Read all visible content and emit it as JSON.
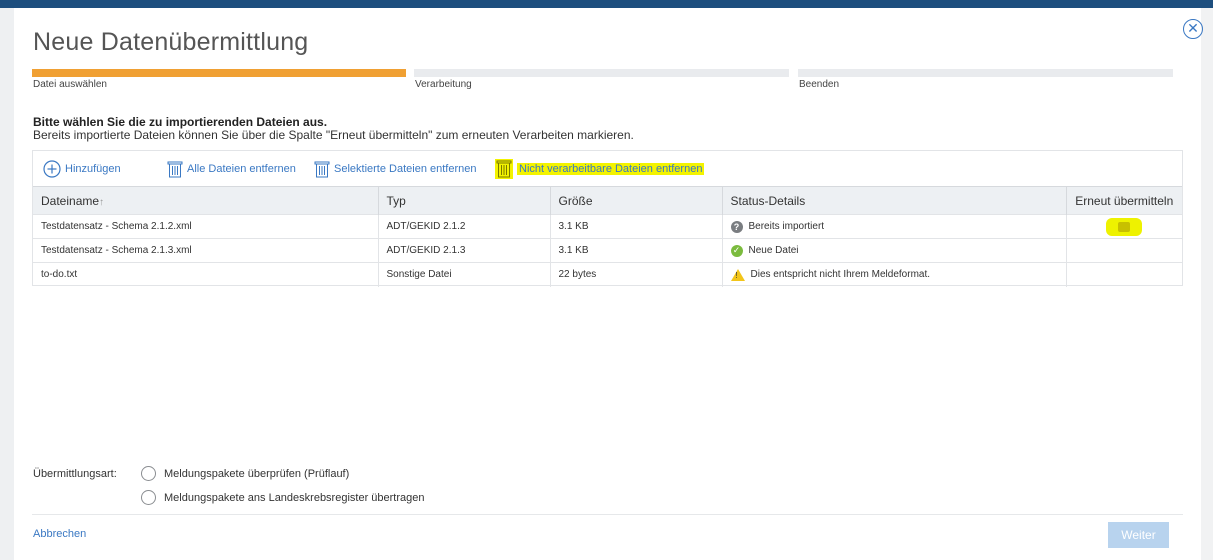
{
  "dialog": {
    "title": "Neue Datenübermittlung",
    "close_icon": "close-circle-icon"
  },
  "steps": [
    {
      "label": "Datei auswählen",
      "active": true
    },
    {
      "label": "Verarbeitung",
      "active": false
    },
    {
      "label": "Beenden",
      "active": false
    }
  ],
  "instructions": {
    "line1": "Bitte wählen Sie die zu importierenden Dateien aus.",
    "line2": "Bereits importierte Dateien können Sie über die Spalte \"Erneut übermitteln\" zum erneuten Verarbeiten markieren."
  },
  "toolbar": {
    "add_label": "Hinzufügen",
    "remove_all_label": "Alle Dateien entfernen",
    "remove_selected_label": "Selektierte Dateien entfernen",
    "remove_unprocessable_label": "Nicht verarbeitbare Dateien entfernen",
    "highlight_color": "#f3f300"
  },
  "table": {
    "columns": [
      "Dateiname",
      "Typ",
      "Größe",
      "Status-Details",
      "Erneut übermitteln"
    ],
    "sort_indicator": "↑",
    "rows": [
      {
        "name": "Testdatensatz - Schema 2.1.2.xml",
        "type": "ADT/GEKID 2.1.2",
        "size": "3.1 KB",
        "status": "Bereits importiert",
        "status_icon": "question-icon"
      },
      {
        "name": "Testdatensatz - Schema 2.1.3.xml",
        "type": "ADT/GEKID 2.1.3",
        "size": "3.1 KB",
        "status": "Neue Datei",
        "status_icon": "check-icon"
      },
      {
        "name": "to-do.txt",
        "type": "Sonstige Datei",
        "size": "22 bytes",
        "status": "Dies entspricht nicht Ihrem Meldeformat.",
        "status_icon": "warning-icon"
      }
    ]
  },
  "transmission": {
    "label": "Übermittlungsart:",
    "options": [
      "Meldungspakete überprüfen (Prüflauf)",
      "Meldungspakete ans Landeskrebsregister übertragen"
    ]
  },
  "footer": {
    "cancel_label": "Abbrechen",
    "next_label": "Weiter"
  },
  "colors": {
    "accent": "#3a78c3",
    "progress": "#f0a033",
    "topbar": "#1d4e7e"
  }
}
